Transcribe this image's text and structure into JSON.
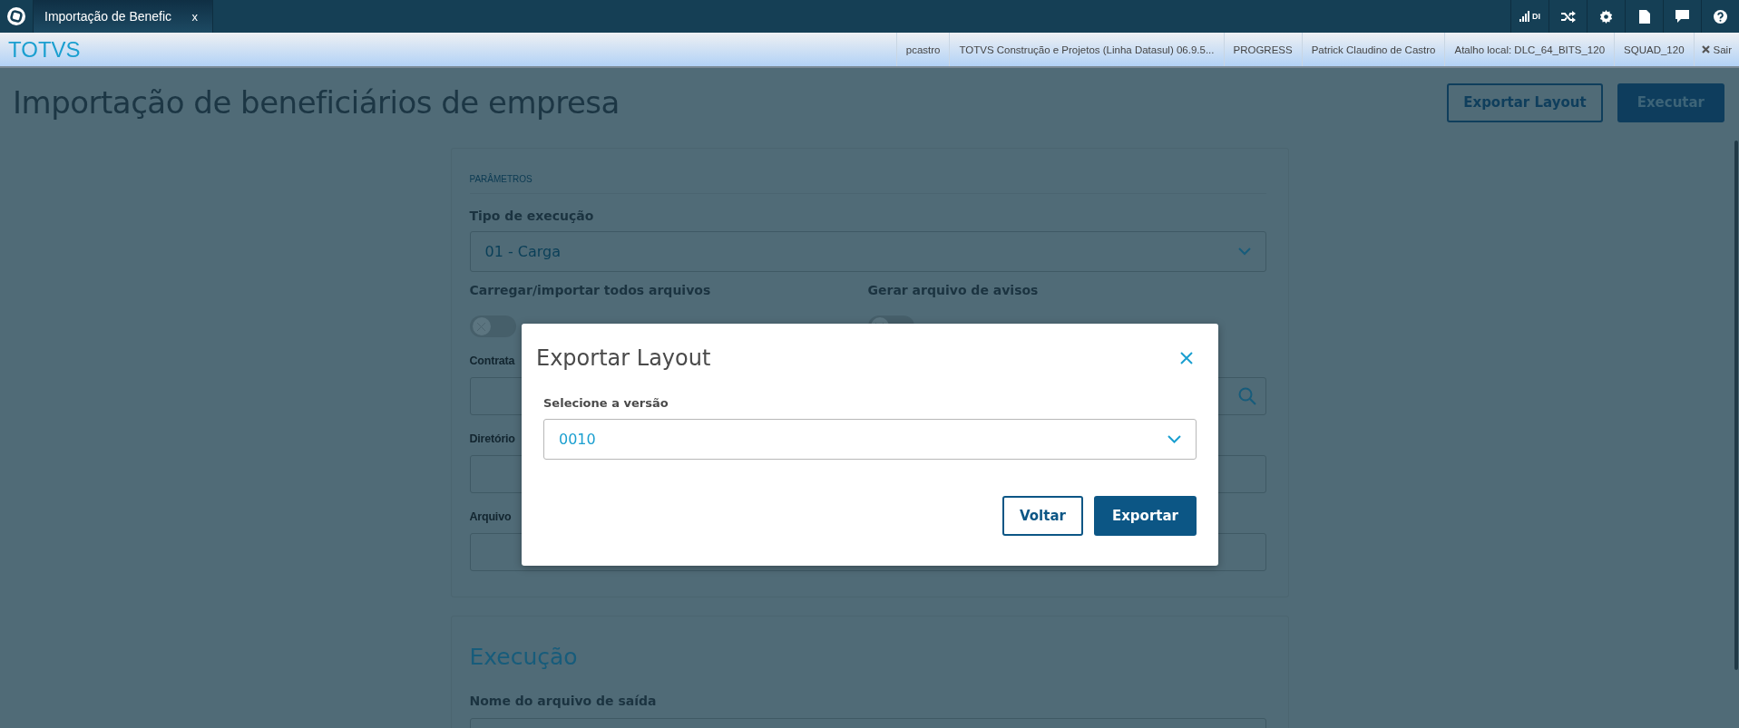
{
  "tab_bar": {
    "tabs": [
      {
        "label": "Importação de Benefic",
        "close": "x",
        "selected": true
      }
    ],
    "tools": [
      {
        "kind": "signal",
        "label": "DI"
      },
      {
        "kind": "shuffle"
      },
      {
        "kind": "settings"
      },
      {
        "kind": "document"
      },
      {
        "kind": "chat"
      },
      {
        "kind": "help"
      }
    ]
  },
  "header": {
    "brand": "TOTVS",
    "info": [
      "pcastro",
      "TOTVS Construção e Projetos (Linha Datasul) 06.9.5...",
      "PROGRESS",
      "Patrick Claudino de Castro",
      "Atalho local: DLC_64_BITS_120",
      "SQUAD_120"
    ],
    "logout": "Sair"
  },
  "page": {
    "title": "Importação de beneficiários de empresa",
    "buttons": [
      {
        "label": "Exportar Layout",
        "kind": "secondary"
      },
      {
        "label": "Executar",
        "kind": "primary"
      }
    ]
  },
  "parameters": {
    "heading": "PARÂMETROS",
    "execution_type": {
      "label": "Tipo de execução",
      "value": "01 - Carga"
    },
    "toggles": [
      {
        "label": "Carregar/importar todos arquivos",
        "on": false
      },
      {
        "label": "Gerar arquivo de avisos",
        "on": false
      }
    ],
    "fields": [
      {
        "label": "Contrata",
        "kind": "search"
      },
      {
        "label": "Diretório",
        "kind": "text"
      },
      {
        "label": "Arquivo",
        "kind": "text"
      }
    ]
  },
  "execution": {
    "heading": "Execução",
    "field_label": "Nome do arquivo de saída"
  },
  "dialog": {
    "title": "Exportar Layout",
    "label": "Selecione a versão",
    "value": "0010",
    "buttons": [
      {
        "label": "Voltar",
        "kind": "secondary"
      },
      {
        "label": "Exportar",
        "kind": "primary"
      }
    ]
  }
}
